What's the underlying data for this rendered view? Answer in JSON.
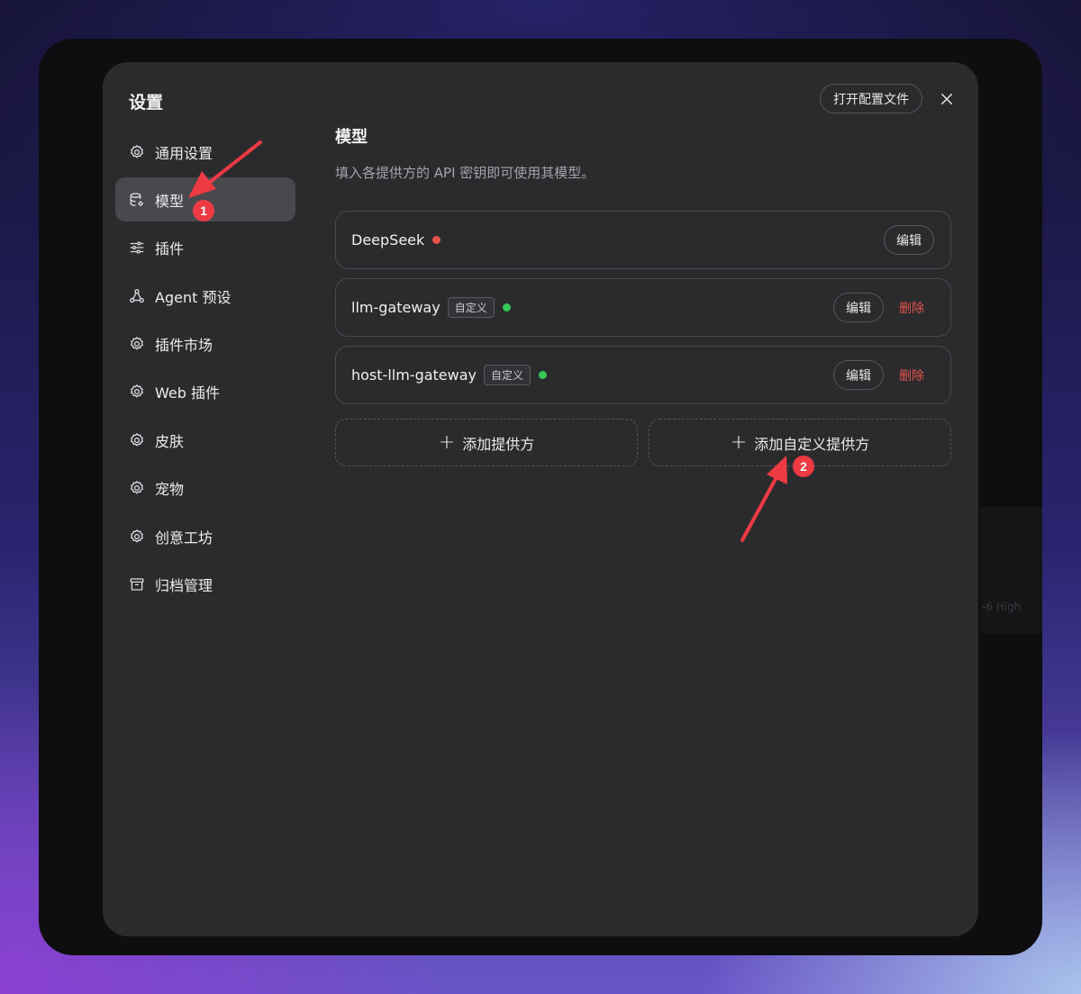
{
  "settings": {
    "title": "设置",
    "open_config_label": "打开配置文件"
  },
  "sidebar": {
    "items": [
      {
        "label": "通用设置",
        "icon": "gear-icon",
        "active": false
      },
      {
        "label": "模型",
        "icon": "database-gear-icon",
        "active": true
      },
      {
        "label": "插件",
        "icon": "sliders-icon",
        "active": false
      },
      {
        "label": "Agent 预设",
        "icon": "agent-network-icon",
        "active": false
      },
      {
        "label": "插件市场",
        "icon": "gear-icon",
        "active": false
      },
      {
        "label": "Web 插件",
        "icon": "gear-icon",
        "active": false
      },
      {
        "label": "皮肤",
        "icon": "gear-icon",
        "active": false
      },
      {
        "label": "宠物",
        "icon": "gear-icon",
        "active": false
      },
      {
        "label": "创意工坊",
        "icon": "gear-icon",
        "active": false
      },
      {
        "label": "归档管理",
        "icon": "archive-icon",
        "active": false
      }
    ]
  },
  "main": {
    "title": "模型",
    "description": "填入各提供方的 API 密钥即可使用其模型。",
    "providers": [
      {
        "name": "DeepSeek",
        "custom_tag": "",
        "status_color": "#e5534b",
        "edit_label": "编辑",
        "delete_label": ""
      },
      {
        "name": "llm-gateway",
        "custom_tag": "自定义",
        "status_color": "#35c759",
        "edit_label": "编辑",
        "delete_label": "删除"
      },
      {
        "name": "host-llm-gateway",
        "custom_tag": "自定义",
        "status_color": "#35c759",
        "edit_label": "编辑",
        "delete_label": "删除"
      }
    ],
    "add_provider_label": "添加提供方",
    "add_custom_provider_label": "添加自定义提供方"
  },
  "annotations": {
    "badge_1": "1",
    "badge_2": "2",
    "arrow_color": "#ee3a43"
  },
  "background": {
    "ghost_text": "-6 High"
  }
}
